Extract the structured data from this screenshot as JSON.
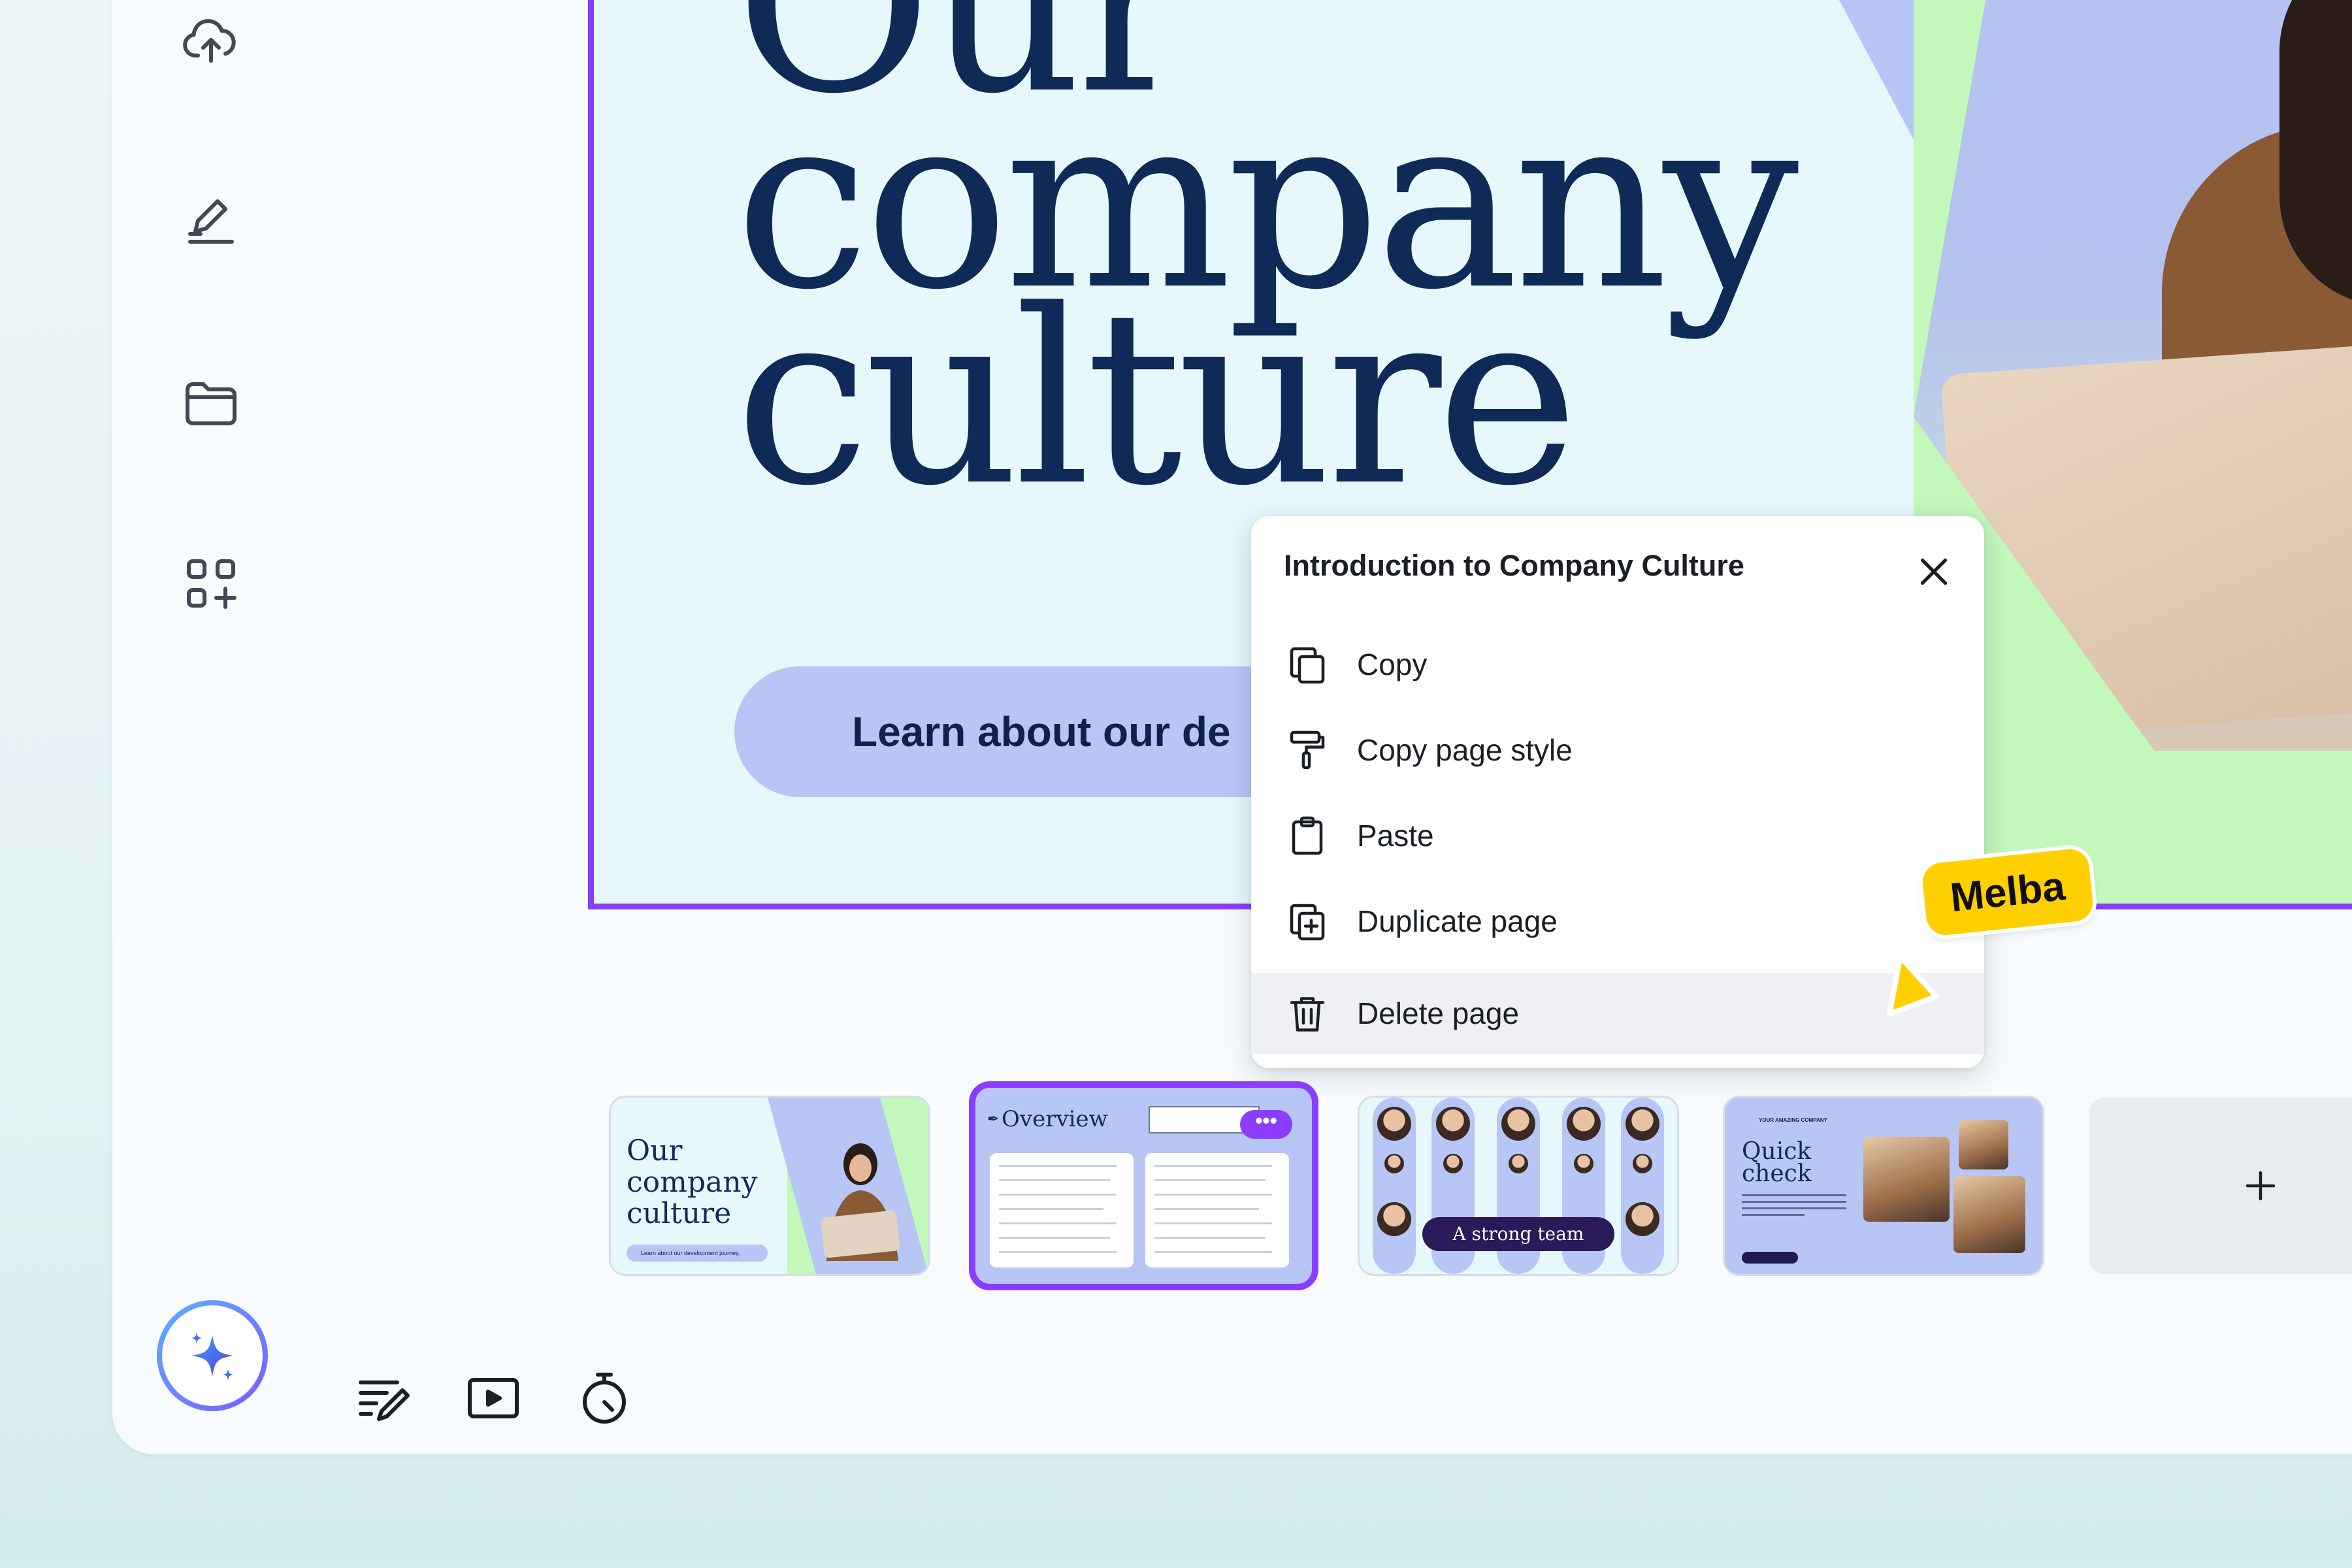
{
  "sidebar": {
    "icons": [
      "cloud-upload-icon",
      "draw-icon",
      "folder-icon",
      "apps-add-icon"
    ]
  },
  "slide": {
    "title": "Our\ncompany\nculture",
    "pill_text": "Learn about our de"
  },
  "context_menu": {
    "title": "Introduction to Company Culture",
    "items": [
      {
        "label": "Copy",
        "icon": "copy-icon"
      },
      {
        "label": "Copy page style",
        "icon": "paint-roller-icon"
      },
      {
        "label": "Paste",
        "icon": "clipboard-icon"
      },
      {
        "label": "Duplicate page",
        "icon": "duplicate-icon"
      },
      {
        "label": "Delete page",
        "icon": "trash-icon"
      }
    ],
    "active_item": "Delete page"
  },
  "collaborator": {
    "name": "Melba",
    "color": "#ffcf00"
  },
  "thumbnails": [
    {
      "title": "Our\ncompany\nculture",
      "pill": "Learn about our development journey."
    },
    {
      "title": "Overview",
      "more_label": "•••"
    },
    {
      "title": "A strong team"
    },
    {
      "brand": "YOUR AMAZING COMPANY",
      "title": "Quick\ncheck"
    }
  ],
  "add_page_label": "+",
  "colors": {
    "accent": "#8b3dff",
    "navy": "#0f2a57",
    "periwinkle": "#b8c6f6",
    "mint": "#c3f8bb",
    "slide_bg": "#e6f8fc"
  }
}
